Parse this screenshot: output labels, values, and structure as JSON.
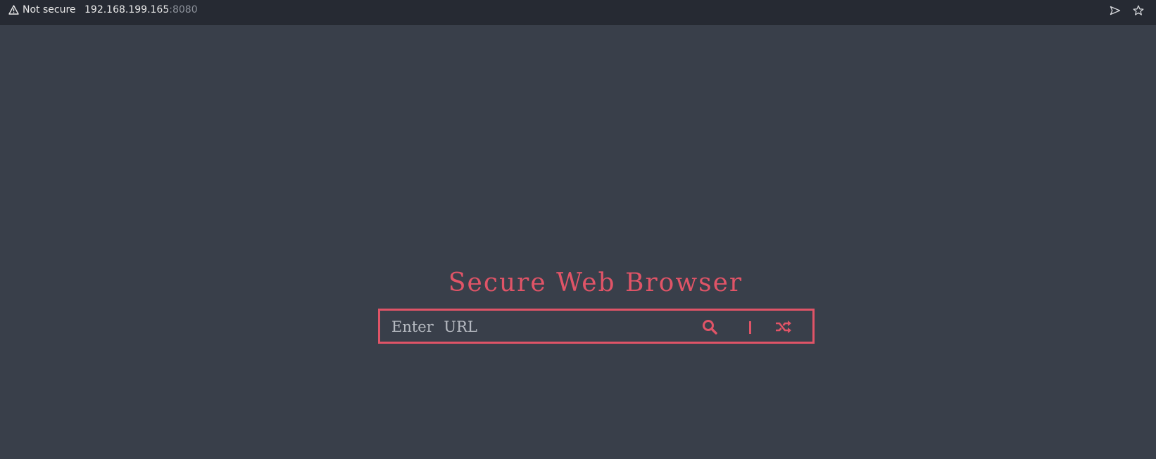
{
  "browser": {
    "security_label": "Not secure",
    "url_host": "192.168.199.165",
    "url_port": ":8080",
    "icons": [
      "warning-icon",
      "send-icon",
      "star-icon"
    ]
  },
  "page": {
    "title": "Secure Web Browser",
    "search": {
      "placeholder": "Enter URL",
      "value": "",
      "icons": [
        "search-icon",
        "shuffle-icon"
      ]
    }
  },
  "colors": {
    "accent": "#e05467",
    "page_background": "#393f4a",
    "topbar_background": "#262a33",
    "port_text": "#8d929b"
  }
}
